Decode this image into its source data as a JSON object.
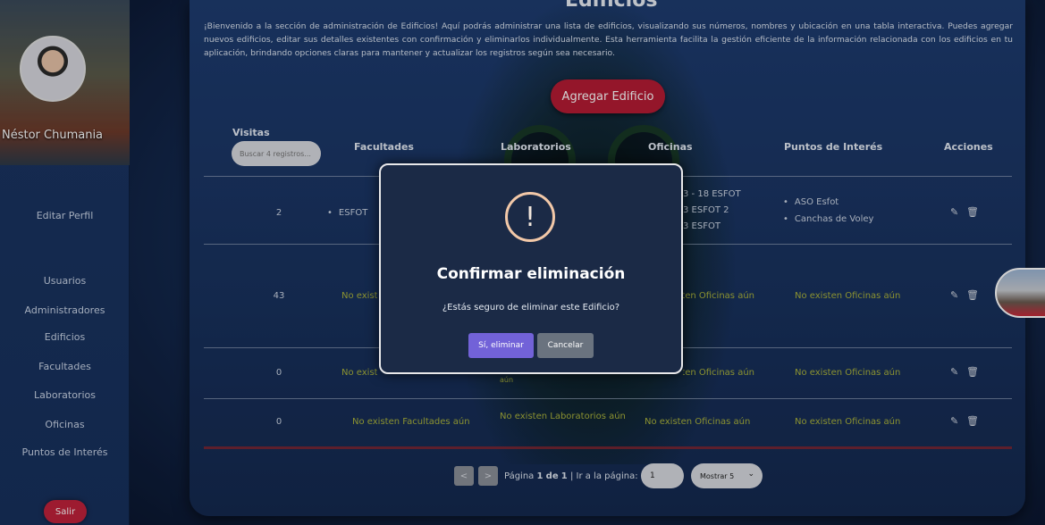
{
  "sidebar": {
    "user_name": "Néstor Chumania",
    "edit_profile": "Editar Perfil",
    "items": [
      {
        "label": "Usuarios"
      },
      {
        "label": "Administradores"
      },
      {
        "label": "Edificios"
      },
      {
        "label": "Facultades"
      },
      {
        "label": "Laboratorios"
      },
      {
        "label": "Oficinas"
      },
      {
        "label": "Puntos de Interés"
      }
    ],
    "logout": "Salir"
  },
  "page": {
    "heading": "Edificios",
    "intro": "¡Bienvenido a la sección de administración de Edificios! Aquí podrás administrar una lista de edificios, visualizando sus números, nombres y ubicación en una tabla interactiva. Puedes agregar nuevos edificios, editar sus detalles existentes con confirmación y eliminarlos individualmente. Esta herramienta facilita la gestión eficiente de la información relacionada con los edificios en tu aplicación, brindando opciones claras para mantener y actualizar los registros según sea necesario.",
    "add_button": "Agregar Edificio"
  },
  "table": {
    "headers": {
      "visits": "Visitas",
      "faculties": "Facultades",
      "labs": "Laboratorios",
      "offices": "Oficinas",
      "poi": "Puntos de Interés",
      "actions": "Acciones"
    },
    "search_placeholder": "Buscar 4 registros...",
    "rows": [
      {
        "visits": "2",
        "faculty": "ESFOT",
        "offices": [
          "3 - 18 ESFOT",
          "3 ESFOT 2",
          "3 ESFOT"
        ],
        "poi": [
          "ASO Esfot",
          "Canchas de Voley"
        ]
      },
      {
        "visits": "43",
        "faculty": "No existen Facultades aún",
        "offices": "No existen Oficinas aún",
        "poi": "No existen Oficinas aún"
      },
      {
        "visits": "0",
        "faculty": "No existen Facultades aún",
        "lab_tail": "aún",
        "offices": "No existen Oficinas aún",
        "poi": "No existen Oficinas aún"
      },
      {
        "visits": "0",
        "faculty": "No existen Facultades aún",
        "labs": "No existen Laboratorios aún",
        "offices": "No existen Oficinas aún",
        "poi": "No existen Oficinas aún"
      }
    ]
  },
  "pagination": {
    "prev": "<",
    "next": ">",
    "page_word": "Página",
    "current": "1",
    "of_word": "de",
    "total": "1",
    "goto_label": "| Ir a la página:",
    "goto_value": "1",
    "show": "Mostrar 5"
  },
  "modal": {
    "icon": "!",
    "title": "Confirmar eliminación",
    "text": "¿Estás seguro de eliminar este Edificio?",
    "confirm": "Sí, eliminar",
    "cancel": "Cancelar"
  },
  "colors": {
    "accent": "#b51c34",
    "confirm": "#7262d8",
    "empty_text": "#aab23b"
  }
}
